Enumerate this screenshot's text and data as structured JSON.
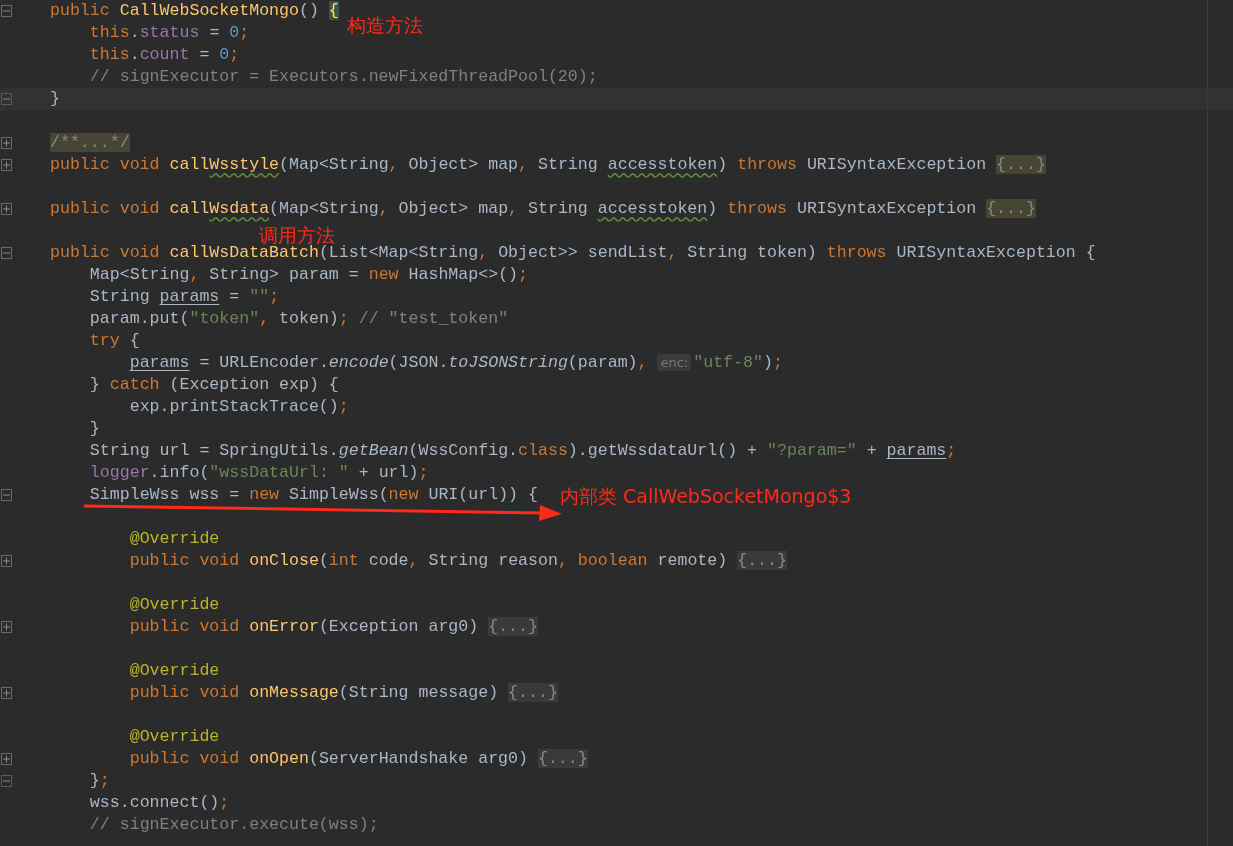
{
  "editor": {
    "lines": [
      {
        "gutter": {
          "kind": "minus"
        },
        "brace_match": true,
        "tokens": [
          {
            "kind": "kw",
            "t": "public "
          },
          {
            "kind": "method",
            "t": "CallWebSocketMongo"
          },
          {
            "kind": "plain",
            "t": "() "
          },
          {
            "kind": "brace",
            "t": "{"
          }
        ]
      },
      {
        "tokens": [
          {
            "kind": "kw",
            "t": "    this"
          },
          {
            "kind": "plain",
            "t": "."
          },
          {
            "kind": "field",
            "t": "status"
          },
          {
            "kind": "plain",
            "t": " = "
          },
          {
            "kind": "num",
            "t": "0"
          },
          {
            "kind": "kw",
            "t": ";"
          }
        ]
      },
      {
        "tokens": [
          {
            "kind": "kw",
            "t": "    this"
          },
          {
            "kind": "plain",
            "t": "."
          },
          {
            "kind": "field",
            "t": "count"
          },
          {
            "kind": "plain",
            "t": " = "
          },
          {
            "kind": "num",
            "t": "0"
          },
          {
            "kind": "kw",
            "t": ";"
          }
        ]
      },
      {
        "tokens": [
          {
            "kind": "comment",
            "t": "    // signExecutor = Executors.newFixedThreadPool(20);"
          }
        ]
      },
      {
        "gutter": {
          "kind": "end"
        },
        "current": true,
        "tokens": [
          {
            "kind": "brace",
            "t": "}"
          }
        ]
      },
      {
        "blank_line_before": true,
        "gutter": {
          "kind": "plus"
        },
        "tokens": [
          {
            "kind": "fold_marked",
            "t": "/**...*/"
          }
        ]
      },
      {
        "gutter": {
          "kind": "plus"
        },
        "tokens": [
          {
            "kind": "kw",
            "t": "public void "
          },
          {
            "kind": "method",
            "t": "call"
          },
          {
            "kind": "method_typo",
            "t": "Wsstyle"
          },
          {
            "kind": "plain",
            "t": "(Map<String"
          },
          {
            "kind": "kw",
            "t": ", "
          },
          {
            "kind": "plain",
            "t": "Object> map"
          },
          {
            "kind": "kw",
            "t": ", "
          },
          {
            "kind": "plain",
            "t": "String "
          },
          {
            "kind": "typo",
            "t": "accesstoken"
          },
          {
            "kind": "plain",
            "t": ") "
          },
          {
            "kind": "kw",
            "t": "throws "
          },
          {
            "kind": "plain",
            "t": "URISyntaxException "
          },
          {
            "kind": "fold_marked",
            "t": "{...}"
          }
        ]
      },
      {
        "blank_line_before": true,
        "gutter": {
          "kind": "plus"
        },
        "tokens": [
          {
            "kind": "kw",
            "t": "public void "
          },
          {
            "kind": "method",
            "t": "call"
          },
          {
            "kind": "method_typo",
            "t": "Wsdata"
          },
          {
            "kind": "plain",
            "t": "(Map<String"
          },
          {
            "kind": "kw",
            "t": ", "
          },
          {
            "kind": "plain",
            "t": "Object> map"
          },
          {
            "kind": "kw",
            "t": ", "
          },
          {
            "kind": "plain",
            "t": "String "
          },
          {
            "kind": "typo",
            "t": "accesstoken"
          },
          {
            "kind": "plain",
            "t": ") "
          },
          {
            "kind": "kw",
            "t": "throws "
          },
          {
            "kind": "plain",
            "t": "URISyntaxException "
          },
          {
            "kind": "fold_marked",
            "t": "{...}"
          }
        ]
      },
      {
        "blank_line_before": true,
        "gutter": {
          "kind": "minus"
        },
        "tokens": [
          {
            "kind": "kw",
            "t": "public void "
          },
          {
            "kind": "method",
            "t": "callWsDataBatch"
          },
          {
            "kind": "plain",
            "t": "(List<Map<String"
          },
          {
            "kind": "kw",
            "t": ", "
          },
          {
            "kind": "plain",
            "t": "Object>> sendList"
          },
          {
            "kind": "kw",
            "t": ", "
          },
          {
            "kind": "plain",
            "t": "String token) "
          },
          {
            "kind": "kw",
            "t": "throws "
          },
          {
            "kind": "plain",
            "t": "URISyntaxException {"
          }
        ]
      },
      {
        "tokens": [
          {
            "kind": "plain",
            "t": "    Map<String"
          },
          {
            "kind": "kw",
            "t": ", "
          },
          {
            "kind": "plain",
            "t": "String> param = "
          },
          {
            "kind": "kw",
            "t": "new "
          },
          {
            "kind": "plain",
            "t": "HashMap<>()"
          },
          {
            "kind": "kw",
            "t": ";"
          }
        ]
      },
      {
        "tokens": [
          {
            "kind": "plain",
            "t": "    String "
          },
          {
            "kind": "var",
            "t": "params"
          },
          {
            "kind": "plain",
            "t": " = "
          },
          {
            "kind": "str",
            "t": "\"\""
          },
          {
            "kind": "kw",
            "t": ";"
          }
        ]
      },
      {
        "tokens": [
          {
            "kind": "plain",
            "t": "    param.put("
          },
          {
            "kind": "str",
            "t": "\"token\""
          },
          {
            "kind": "kw",
            "t": ", "
          },
          {
            "kind": "plain",
            "t": "token)"
          },
          {
            "kind": "kw",
            "t": "; "
          },
          {
            "kind": "comment",
            "t": "// \"test_token\""
          }
        ]
      },
      {
        "tokens": [
          {
            "kind": "kw",
            "t": "    try "
          },
          {
            "kind": "plain",
            "t": "{"
          }
        ]
      },
      {
        "tokens": [
          {
            "kind": "var",
            "t": "        params"
          },
          {
            "kind": "plain",
            "t": " = URLEncoder."
          },
          {
            "kind": "italic",
            "t": "encode"
          },
          {
            "kind": "plain",
            "t": "(JSON."
          },
          {
            "kind": "italic",
            "t": "toJSONString"
          },
          {
            "kind": "plain",
            "t": "(param)"
          },
          {
            "kind": "kw",
            "t": ", "
          },
          {
            "kind": "hint",
            "t": "enc:"
          },
          {
            "kind": "str",
            "t": "\"utf-8\""
          },
          {
            "kind": "plain",
            "t": ")"
          },
          {
            "kind": "kw",
            "t": ";"
          }
        ]
      },
      {
        "tokens": [
          {
            "kind": "plain",
            "t": "    } "
          },
          {
            "kind": "kw",
            "t": "catch "
          },
          {
            "kind": "plain",
            "t": "(Exception exp) {"
          }
        ]
      },
      {
        "tokens": [
          {
            "kind": "plain",
            "t": "        exp.printStackTrace()"
          },
          {
            "kind": "kw",
            "t": ";"
          }
        ]
      },
      {
        "tokens": [
          {
            "kind": "plain",
            "t": "    }"
          }
        ]
      },
      {
        "tokens": [
          {
            "kind": "plain",
            "t": "    String url = SpringUtils."
          },
          {
            "kind": "italic",
            "t": "getBean"
          },
          {
            "kind": "plain",
            "t": "(WssConfig."
          },
          {
            "kind": "kw",
            "t": "class"
          },
          {
            "kind": "plain",
            "t": ").getWssdataUrl() + "
          },
          {
            "kind": "str",
            "t": "\"?param=\""
          },
          {
            "kind": "plain",
            "t": " + "
          },
          {
            "kind": "var",
            "t": "params"
          },
          {
            "kind": "kw",
            "t": ";"
          }
        ]
      },
      {
        "tokens": [
          {
            "kind": "field",
            "t": "    logger"
          },
          {
            "kind": "plain",
            "t": ".info("
          },
          {
            "kind": "str",
            "t": "\"wssDataUrl: \""
          },
          {
            "kind": "plain",
            "t": " + url)"
          },
          {
            "kind": "kw",
            "t": ";"
          }
        ]
      },
      {
        "gutter": {
          "kind": "minus"
        },
        "tokens": [
          {
            "kind": "plain",
            "t": "    SimpleWss wss = "
          },
          {
            "kind": "kw",
            "t": "new "
          },
          {
            "kind": "plain",
            "t": "SimpleWss("
          },
          {
            "kind": "kw",
            "t": "new "
          },
          {
            "kind": "plain",
            "t": "URI(url)) {"
          }
        ]
      },
      {
        "blank_line_before": true,
        "tokens": [
          {
            "kind": "annot",
            "t": "        @Override"
          }
        ]
      },
      {
        "gutter": {
          "kind": "plus"
        },
        "tokens": [
          {
            "kind": "kw",
            "t": "        public void "
          },
          {
            "kind": "method",
            "t": "onClose"
          },
          {
            "kind": "plain",
            "t": "("
          },
          {
            "kind": "kw",
            "t": "int "
          },
          {
            "kind": "plain",
            "t": "code"
          },
          {
            "kind": "kw",
            "t": ", "
          },
          {
            "kind": "plain",
            "t": "String reason"
          },
          {
            "kind": "kw",
            "t": ", boolean "
          },
          {
            "kind": "plain",
            "t": "remote) "
          },
          {
            "kind": "fold",
            "t": "{...}"
          }
        ]
      },
      {
        "blank_line_before": true,
        "tokens": [
          {
            "kind": "annot",
            "t": "        @Override"
          }
        ]
      },
      {
        "gutter": {
          "kind": "plus"
        },
        "tokens": [
          {
            "kind": "kw",
            "t": "        public void "
          },
          {
            "kind": "method",
            "t": "onError"
          },
          {
            "kind": "plain",
            "t": "(Exception arg0) "
          },
          {
            "kind": "fold",
            "t": "{...}"
          }
        ]
      },
      {
        "blank_line_before": true,
        "tokens": [
          {
            "kind": "annot",
            "t": "        @Override"
          }
        ]
      },
      {
        "gutter": {
          "kind": "plus"
        },
        "tokens": [
          {
            "kind": "kw",
            "t": "        public void "
          },
          {
            "kind": "method",
            "t": "onMessage"
          },
          {
            "kind": "plain",
            "t": "(String message) "
          },
          {
            "kind": "fold",
            "t": "{...}"
          }
        ]
      },
      {
        "blank_line_before": true,
        "tokens": [
          {
            "kind": "annot",
            "t": "        @Override"
          }
        ]
      },
      {
        "gutter": {
          "kind": "plus"
        },
        "tokens": [
          {
            "kind": "kw",
            "t": "        public void "
          },
          {
            "kind": "method",
            "t": "onOpen"
          },
          {
            "kind": "plain",
            "t": "(ServerHandshake arg0) "
          },
          {
            "kind": "fold",
            "t": "{...}"
          }
        ]
      },
      {
        "gutter": {
          "kind": "end"
        },
        "tokens": [
          {
            "kind": "plain",
            "t": "    }"
          },
          {
            "kind": "kw",
            "t": ";"
          }
        ]
      },
      {
        "tokens": [
          {
            "kind": "plain",
            "t": "    wss.connect()"
          },
          {
            "kind": "kw",
            "t": ";"
          }
        ]
      },
      {
        "tokens": [
          {
            "kind": "comment",
            "t": "    // signExecutor.execute(wss);"
          }
        ]
      }
    ]
  },
  "annotations": [
    {
      "text": "构造方法"
    },
    {
      "text": "调用方法"
    },
    {
      "text": "内部类 CallWebSocketMongo$3",
      "arrow": true
    }
  ]
}
